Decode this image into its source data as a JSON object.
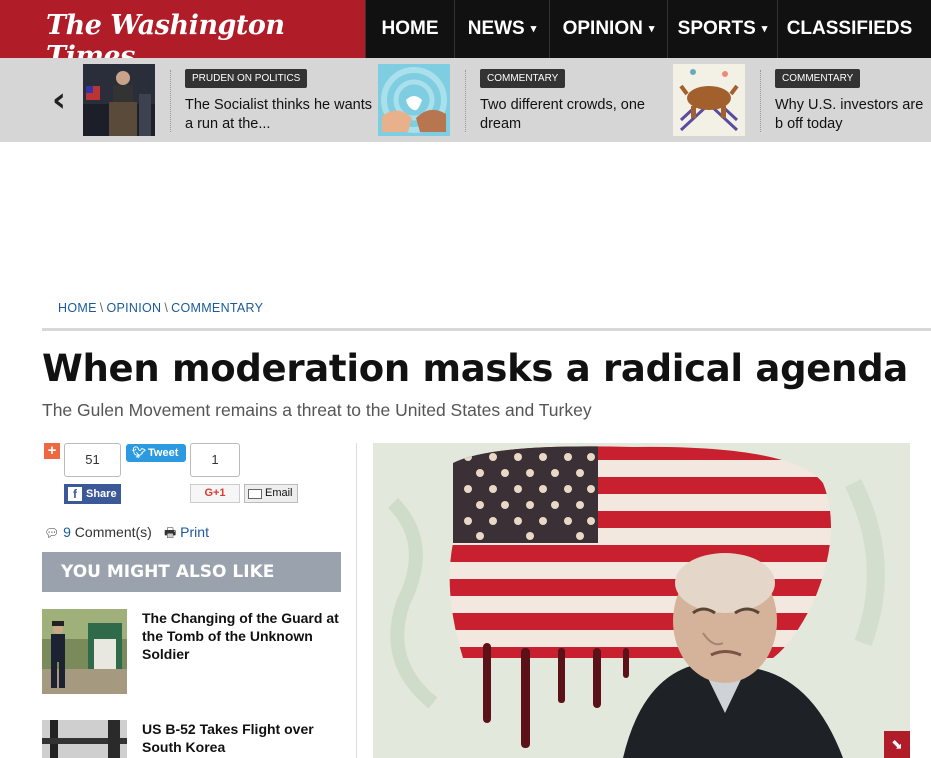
{
  "site": {
    "logo": "The Washington Times",
    "brand_color": "#b01c27"
  },
  "nav": [
    {
      "label": "HOME",
      "caret": ""
    },
    {
      "label": "NEWS",
      "caret": "▾"
    },
    {
      "label": "OPINION",
      "caret": "▾"
    },
    {
      "label": "SPORTS",
      "caret": "▾"
    },
    {
      "label": "CLASSIFIEDS",
      "caret": ""
    }
  ],
  "carousel": {
    "prev_icon": "chevron-left-icon",
    "items": [
      {
        "tag": "PRUDEN ON POLITICS",
        "title": "The Socialist thinks he wants a run at the..."
      },
      {
        "tag": "COMMENTARY",
        "title": "Two different crowds, one dream"
      },
      {
        "tag": "COMMENTARY",
        "title": "Why U.S. investors are b off today"
      }
    ]
  },
  "breadcrumb": [
    "HOME",
    "OPINION",
    "COMMENTARY"
  ],
  "breadcrumb_sep": "\\",
  "article": {
    "title": "When moderation masks a radical agenda",
    "subtitle": "The Gulen Movement remains a threat to the United States and Turkey"
  },
  "share": {
    "plus": "+",
    "fb_count": "51",
    "fb_label": "Share",
    "tweet_label": "Tweet",
    "gplus_count": "1",
    "gplus_label": "G+1",
    "email_label": "Email"
  },
  "meta": {
    "comments_count": "9",
    "comments_label": " Comment(s)",
    "print_label": "Print"
  },
  "related": {
    "heading": "YOU MIGHT ALSO LIKE",
    "items": [
      {
        "title": "The Changing of the Guard at the Tomb of the Unknown Soldier"
      },
      {
        "title": "US B-52 Takes Flight over South Korea"
      }
    ]
  }
}
